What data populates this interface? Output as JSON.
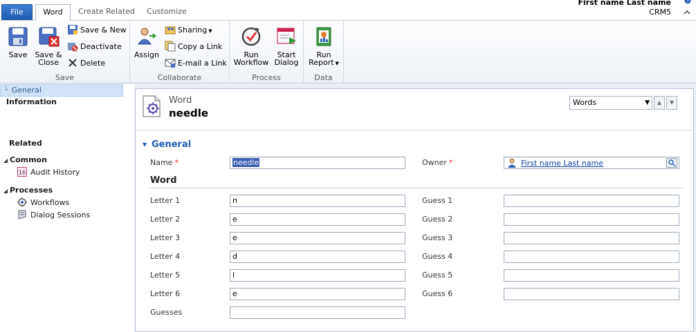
{
  "tabs": {
    "file": "File",
    "word": "Word",
    "create_related": "Create Related",
    "customize": "Customize"
  },
  "user": {
    "name": "First name Last name",
    "org": "CRM5"
  },
  "ribbon": {
    "save_group": {
      "label": "Save",
      "save": "Save",
      "save_close_line1": "Save &",
      "save_close_line2": "Close",
      "save_new": "Save & New",
      "deactivate": "Deactivate",
      "delete": "Delete"
    },
    "collaborate_group": {
      "label": "Collaborate",
      "assign": "Assign",
      "sharing": "Sharing",
      "copy_link": "Copy a Link",
      "email_link": "E-mail a Link"
    },
    "process_group": {
      "label": "Process",
      "run_workflow_line1": "Run",
      "run_workflow_line2": "Workflow",
      "start_dialog_line1": "Start",
      "start_dialog_line2": "Dialog"
    },
    "data_group": {
      "label": "Data",
      "run_report_line1": "Run",
      "run_report_line2": "Report"
    }
  },
  "leftnav": {
    "information": "Information",
    "general": "General",
    "related": "Related",
    "common": "Common",
    "audit_history": "Audit History",
    "processes": "Processes",
    "workflows": "Workflows",
    "dialog_sessions": "Dialog Sessions"
  },
  "header": {
    "entity_type": "Word",
    "record_name": "needle",
    "view_select": "Words"
  },
  "form": {
    "section_title": "General",
    "name_label": "Name",
    "name_value": "needle",
    "owner_label": "Owner",
    "owner_value": "First name Last name",
    "subsection_title": "Word",
    "letters": [
      {
        "label": "Letter 1",
        "value": "n"
      },
      {
        "label": "Letter 2",
        "value": "e"
      },
      {
        "label": "Letter 3",
        "value": "e"
      },
      {
        "label": "Letter 4",
        "value": "d"
      },
      {
        "label": "Letter 5",
        "value": "l"
      },
      {
        "label": "Letter 6",
        "value": "e"
      }
    ],
    "guesses": [
      {
        "label": "Guess 1",
        "value": ""
      },
      {
        "label": "Guess 2",
        "value": ""
      },
      {
        "label": "Guess 3",
        "value": ""
      },
      {
        "label": "Guess 4",
        "value": ""
      },
      {
        "label": "Guess 5",
        "value": ""
      },
      {
        "label": "Guess 6",
        "value": ""
      }
    ],
    "guesses_label": "Guesses",
    "guesses_value": ""
  },
  "colors": {
    "accent": "#1f5bb3",
    "selection": "#d2e2f6",
    "required": "#dd2222"
  }
}
